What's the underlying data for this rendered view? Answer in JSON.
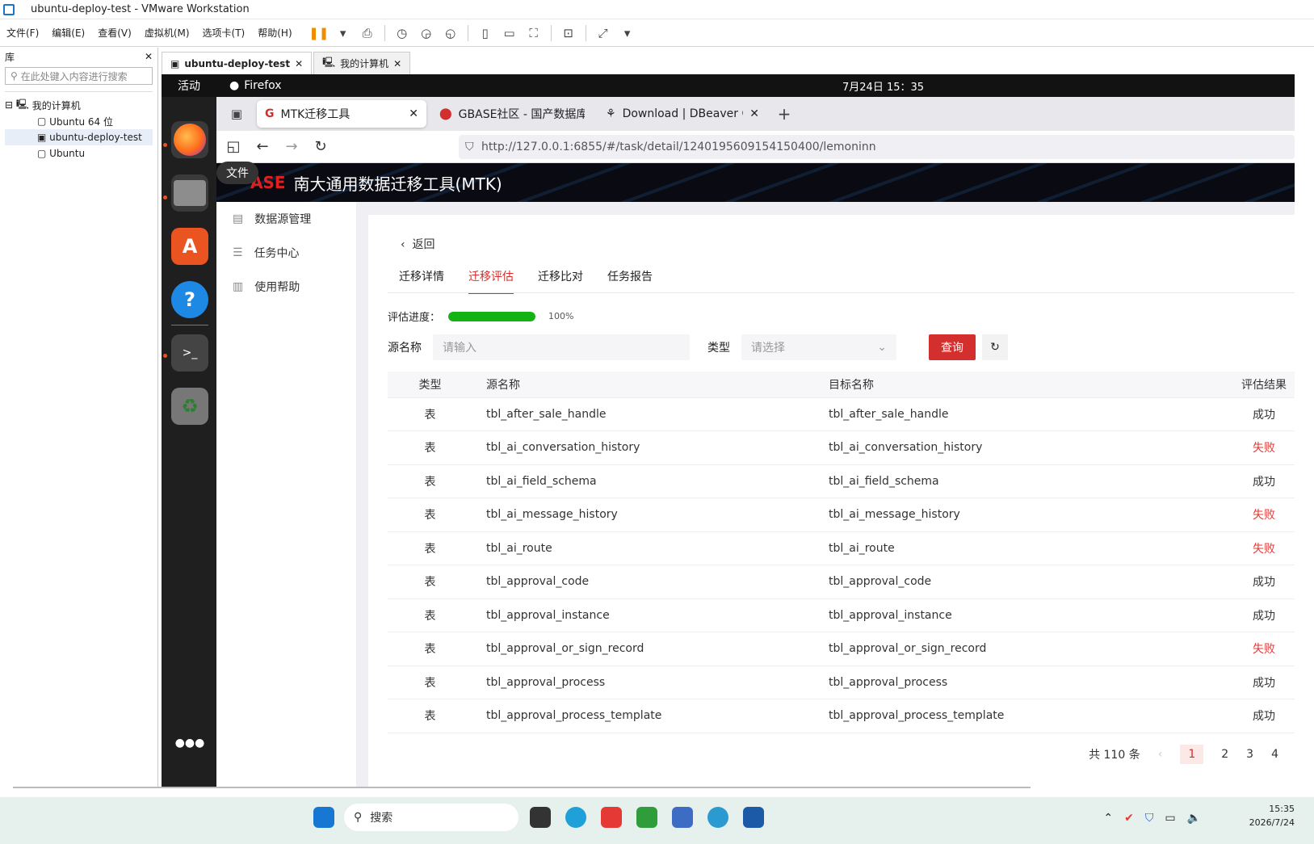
{
  "window": {
    "title": "ubuntu-deploy-test - VMware Workstation"
  },
  "menu": [
    "文件(F)",
    "编辑(E)",
    "查看(V)",
    "虚拟机(M)",
    "选项卡(T)",
    "帮助(H)"
  ],
  "library": {
    "title": "库",
    "search_placeholder": "在此处键入内容进行搜索",
    "root": "我的计算机",
    "items": [
      "Ubuntu 64 位",
      "ubuntu-deploy-test",
      "Ubuntu"
    ]
  },
  "vm_tabs": [
    "ubuntu-deploy-test",
    "我的计算机"
  ],
  "gnome": {
    "activities": "活动",
    "app": "Firefox",
    "clock": "7月24日 15：35",
    "tooltip": "文件"
  },
  "firefox": {
    "tabs": [
      "MTK迁移工具",
      "GBASE社区 - 国产数据库技",
      "Download | DBeaver Com"
    ],
    "url": "http://127.0.0.1:6855/#/task/detail/1240195609154150400/lemoninn"
  },
  "app": {
    "brand": "ASE",
    "title": "南大通用数据迁移工具(MTK)",
    "nav": [
      "数据源管理",
      "任务中心",
      "使用帮助"
    ],
    "back": "返回",
    "tabs": [
      "迁移详情",
      "迁移评估",
      "迁移比对",
      "任务报告"
    ],
    "progress_label": "评估进度：",
    "progress_pct": "100%",
    "progress_value": 1.0,
    "filter": {
      "source_label": "源名称",
      "source_placeholder": "请输入",
      "type_label": "类型",
      "type_placeholder": "请选择",
      "query": "查询"
    },
    "table": {
      "headers": [
        "类型",
        "源名称",
        "目标名称",
        "评估结果"
      ],
      "rows": [
        [
          "表",
          "tbl_after_sale_handle",
          "tbl_after_sale_handle",
          "成功"
        ],
        [
          "表",
          "tbl_ai_conversation_history",
          "tbl_ai_conversation_history",
          "失败"
        ],
        [
          "表",
          "tbl_ai_field_schema",
          "tbl_ai_field_schema",
          "成功"
        ],
        [
          "表",
          "tbl_ai_message_history",
          "tbl_ai_message_history",
          "失败"
        ],
        [
          "表",
          "tbl_ai_route",
          "tbl_ai_route",
          "失败"
        ],
        [
          "表",
          "tbl_approval_code",
          "tbl_approval_code",
          "成功"
        ],
        [
          "表",
          "tbl_approval_instance",
          "tbl_approval_instance",
          "成功"
        ],
        [
          "表",
          "tbl_approval_or_sign_record",
          "tbl_approval_or_sign_record",
          "失败"
        ],
        [
          "表",
          "tbl_approval_process",
          "tbl_approval_process",
          "成功"
        ],
        [
          "表",
          "tbl_approval_process_template",
          "tbl_approval_process_template",
          "成功"
        ]
      ]
    },
    "pager": {
      "total": "共 110 条",
      "pages": [
        "1",
        "2",
        "3",
        "4"
      ]
    }
  },
  "taskbar": {
    "search": "搜索",
    "time": "15:35",
    "date": "2026/7/24"
  },
  "colors": {
    "accent": "#d32f2f",
    "success_bar": "#13b313"
  }
}
